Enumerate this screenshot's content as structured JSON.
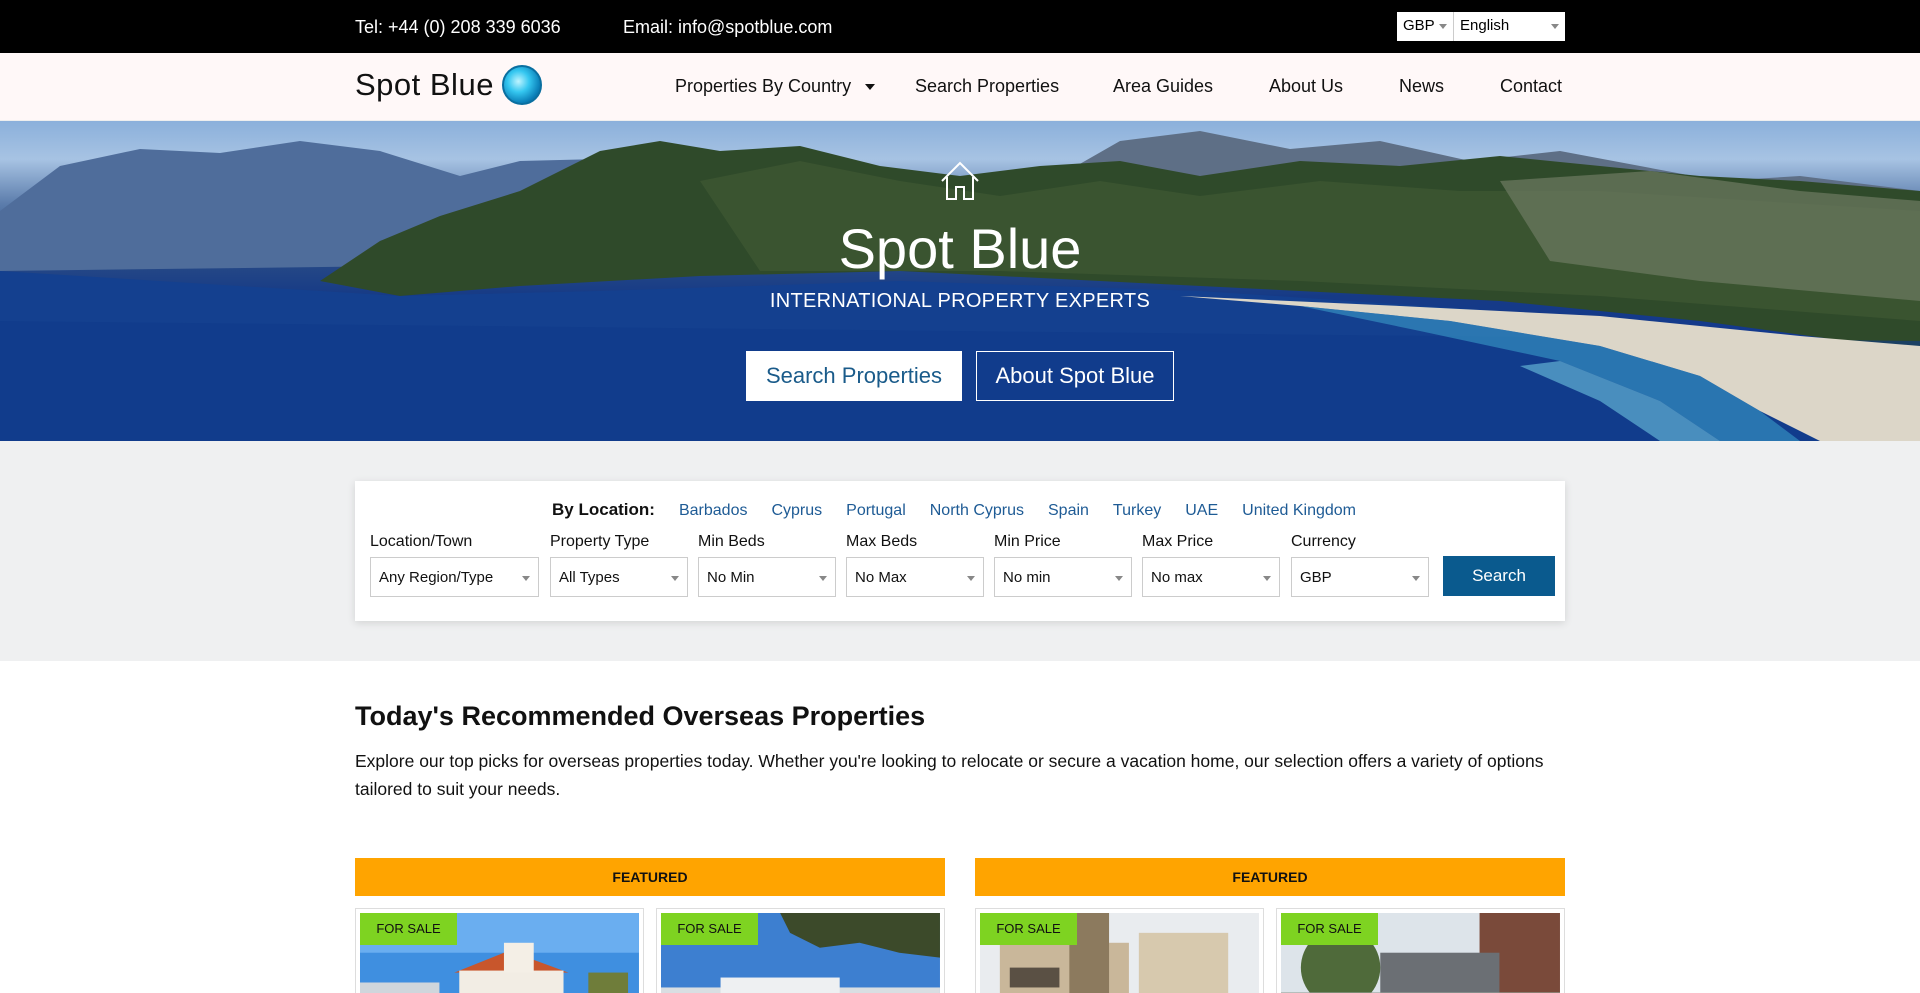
{
  "topbar": {
    "tel": "Tel: +44 (0) 208 339 6036",
    "email": "Email: info@spotblue.com",
    "currency": "GBP",
    "language": "English"
  },
  "nav": {
    "logo_text": "Spot Blue",
    "items": [
      {
        "label": "Properties By Country"
      },
      {
        "label": "Search Properties"
      },
      {
        "label": "Area Guides"
      },
      {
        "label": "About Us"
      },
      {
        "label": "News"
      },
      {
        "label": "Contact"
      }
    ]
  },
  "hero": {
    "title": "Spot Blue",
    "subtitle": "INTERNATIONAL PROPERTY EXPERTS",
    "primary_button": "Search Properties",
    "secondary_button": "About Spot Blue"
  },
  "search": {
    "by_location_label": "By Location:",
    "locations": [
      "Barbados",
      "Cyprus",
      "Portugal",
      "North Cyprus",
      "Spain",
      "Turkey",
      "UAE",
      "United Kingdom"
    ],
    "fields": [
      {
        "label": "Location/Town",
        "value": "Any Region/Type"
      },
      {
        "label": "Property Type",
        "value": "All Types"
      },
      {
        "label": "Min Beds",
        "value": "No Min"
      },
      {
        "label": "Max Beds",
        "value": "No Max"
      },
      {
        "label": "Min Price",
        "value": "No min"
      },
      {
        "label": "Max Price",
        "value": "No max"
      },
      {
        "label": "Currency",
        "value": "GBP"
      }
    ],
    "button": "Search"
  },
  "recommended": {
    "title": "Today's Recommended Overseas Properties",
    "description": "Explore our top picks for overseas properties today. Whether you're looking to relocate or secure a vacation home, our selection offers a variety of options tailored to suit your needs.",
    "featured_label": "FEATURED",
    "tag": "FOR SALE"
  },
  "colors": {
    "accent": "#0a5a8e",
    "featured": "#ffa400",
    "for_sale": "#7ed321",
    "link": "#1e5b95"
  }
}
